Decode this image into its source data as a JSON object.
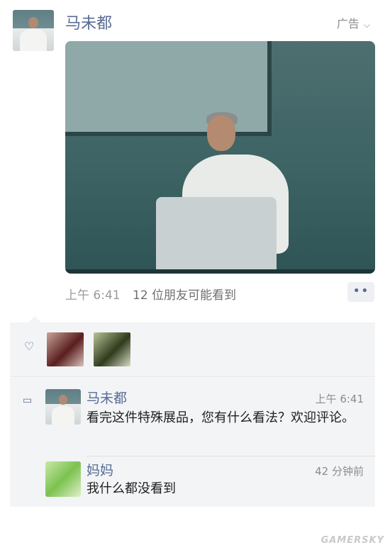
{
  "post": {
    "author": "马未都",
    "ad_label": "广告",
    "ad_chevron": "chevron-down-icon",
    "time": "上午 6:41",
    "visibility": "12 位朋友可能看到",
    "more_label": "••"
  },
  "comments": [
    {
      "author": "马未都",
      "time": "上午 6:41",
      "text": "看完这件特殊展品，您有什么看法？欢迎评论。"
    },
    {
      "author": "妈妈",
      "time": "42 分钟前",
      "text": "我什么都没看到"
    }
  ],
  "watermark": "GAMERSKY",
  "colors": {
    "link_blue": "#576b95",
    "panel_gray": "#f3f4f6"
  }
}
